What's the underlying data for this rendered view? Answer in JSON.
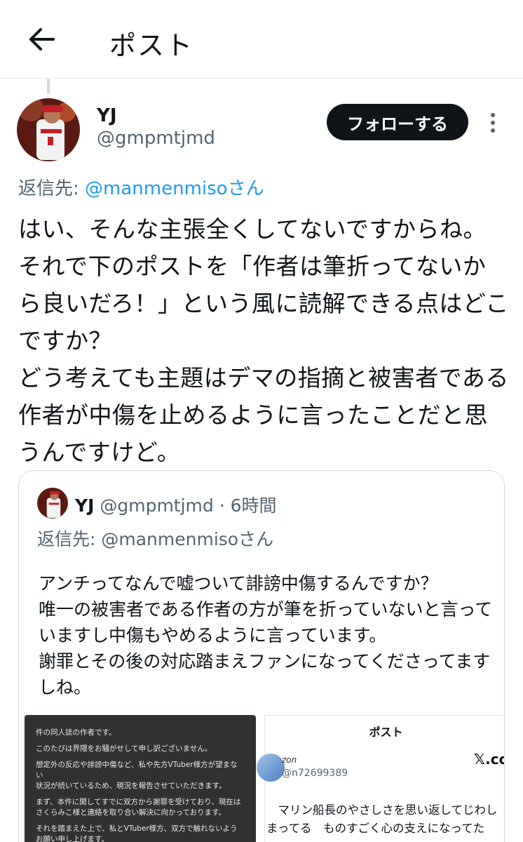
{
  "header": {
    "title": "ポスト",
    "back_icon": "arrow-left-icon"
  },
  "post": {
    "display_name": "YJ",
    "handle": "@gmpmtjmd",
    "follow_label": "フォローする",
    "more_icon": "more-vertical-icon",
    "reply_prefix": "返信先: ",
    "reply_mention": "@manmenmisoさん",
    "body": "はい、そんな主張全くしてないですからね。\nそれで下のポストを「作者は筆折ってないから良いだろ！」という風に読解できる点はどこですか？\nどう考えても主題はデマの指摘と被害者である作者が中傷を止めるように言ったことだと思うんですけど。"
  },
  "quote": {
    "display_name": "YJ",
    "handle_time": " @gmpmtjmd · 6時間",
    "reply": "返信先: @manmenmisoさん",
    "body": "アンチってなんで嘘ついて誹謗中傷するんですか？\n唯一の被害者である作者の方が筆を折っていないと言っていますし中傷もやめるように言っています。\n謝罪とその後の対応踏まえファンになってくださってますしね。",
    "image_left": {
      "p1": "件の同人誌の作者です。",
      "p2": "このたびは界隈をお騒がせして申し訳ございません。",
      "p3": "想定外の反応や誹謗中傷など、私や先方VTuber様方が望まない\n状況が続いているため、現況を報告させていただきます。",
      "p4": "まず、本件に関してすでに双方から謝罪を受けており、現在は\nさくらみこ様と連絡を取り合い解決に向かっております。",
      "p5": "それを踏まえた上で、私とVTuber様方、双方で触れないよう\nお願い申し上げます。"
    },
    "image_right": {
      "title": "ポスト",
      "name": "zon",
      "handle": "@n72699389",
      "x_label": "𝕏.co",
      "text": "　マリン船長のやさしさを思い返してじわし\nまってる　ものすごく心の支えになってた"
    }
  },
  "colors": {
    "accent": "#1d9bf0",
    "text": "#0f1419",
    "muted": "#536471",
    "button_bg": "#0f1419"
  }
}
